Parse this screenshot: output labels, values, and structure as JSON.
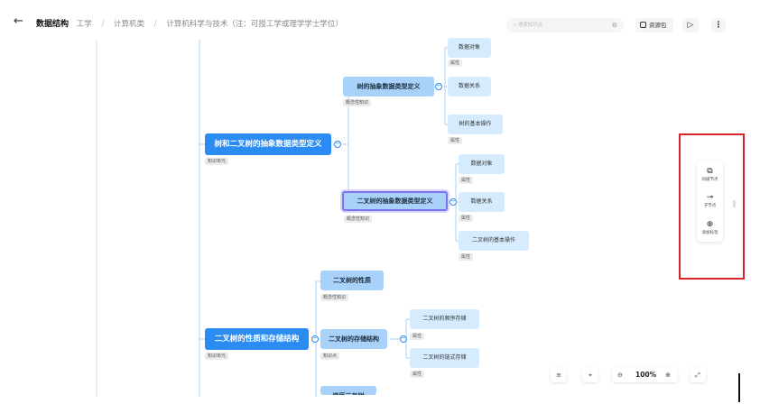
{
  "header": {
    "back_icon": "←",
    "title": "数据结构",
    "crumbs": [
      "工学",
      "计算机类",
      "计算机科学与技术（注：可授工学或理学学士学位）"
    ],
    "separator": "/",
    "search_placeholder": "搜索知识点",
    "resource_label": "资源包"
  },
  "mindmap": {
    "unit1": {
      "label": "树和二叉树的抽象数据类型定义",
      "tag": "知识单元"
    },
    "tree_adt": {
      "label": "树的抽象数据类型定义",
      "tag": "概念性知识"
    },
    "tree_items": [
      {
        "label": "数据对象",
        "tag": "属性"
      },
      {
        "label": "数据关系",
        "tag": "属性"
      },
      {
        "label": "树的基本操作",
        "tag": "属性"
      }
    ],
    "btree_adt": {
      "label": "二叉树的抽象数据类型定义",
      "tag": "概念性知识"
    },
    "btree_items": [
      {
        "label": "数据对象",
        "tag": "属性"
      },
      {
        "label": "数据关系",
        "tag": "属性"
      },
      {
        "label": "二叉树的基本操作",
        "tag": "属性"
      }
    ],
    "unit2": {
      "label": "二叉树的性质和存储结构",
      "tag": "知识单元"
    },
    "btree_prop": {
      "label": "二叉树的性质",
      "tag": "概念性知识"
    },
    "btree_store": {
      "label": "二叉树的存储结构",
      "tag": "知识点"
    },
    "store_items": [
      {
        "label": "二叉树的顺序存储",
        "tag": "属性"
      },
      {
        "label": "二叉树的链式存储",
        "tag": "属性"
      }
    ],
    "partial_label": "遍历二叉树"
  },
  "side_panel": {
    "items": [
      {
        "label": "同级节点",
        "icon": "copy-icon"
      },
      {
        "label": "子节点",
        "icon": "child-node-icon"
      },
      {
        "label": "添加标签",
        "icon": "add-tag-icon"
      }
    ]
  },
  "bottom_bar": {
    "zoom": "100%"
  },
  "colors": {
    "level1": "#2a8bf2",
    "level2": "#a9d2fb",
    "level3": "#d6ebfe",
    "selected_border": "#7b72f0",
    "highlight_box": "#d8232a"
  }
}
